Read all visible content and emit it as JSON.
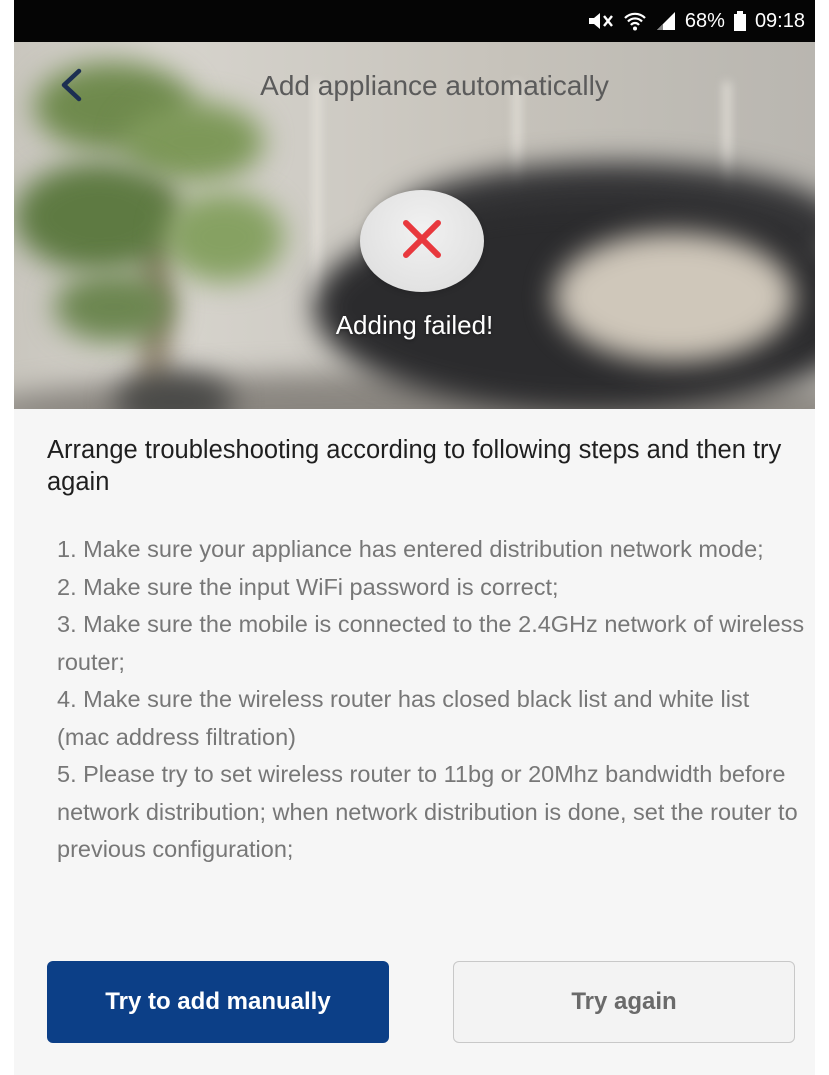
{
  "status_bar": {
    "battery": "68%",
    "time": "09:18"
  },
  "header": {
    "title": "Add appliance automatically"
  },
  "result": {
    "message": "Adding failed!"
  },
  "content": {
    "heading": "Arrange troubleshooting according to following steps and then try again",
    "steps": [
      "1. Make sure your appliance has entered distribution network mode;",
      "2. Make sure the input WiFi password is correct;",
      "3. Make sure the mobile is connected to the 2.4GHz network of wireless router;",
      "4. Make sure the wireless router has closed black list and white list (mac address filtration)",
      "5. Please try to set wireless router to 11bg or 20Mhz bandwidth before network distribution; when network distribution is done, set the router to previous configuration;"
    ]
  },
  "actions": {
    "manual_label": "Try to add manually",
    "retry_label": "Try again"
  },
  "colors": {
    "primary": "#0c3f87",
    "error": "#e8383d"
  },
  "icons": [
    "mute-icon",
    "wifi-icon",
    "signal-icon",
    "battery-icon",
    "back-arrow-icon",
    "close-x-icon"
  ]
}
